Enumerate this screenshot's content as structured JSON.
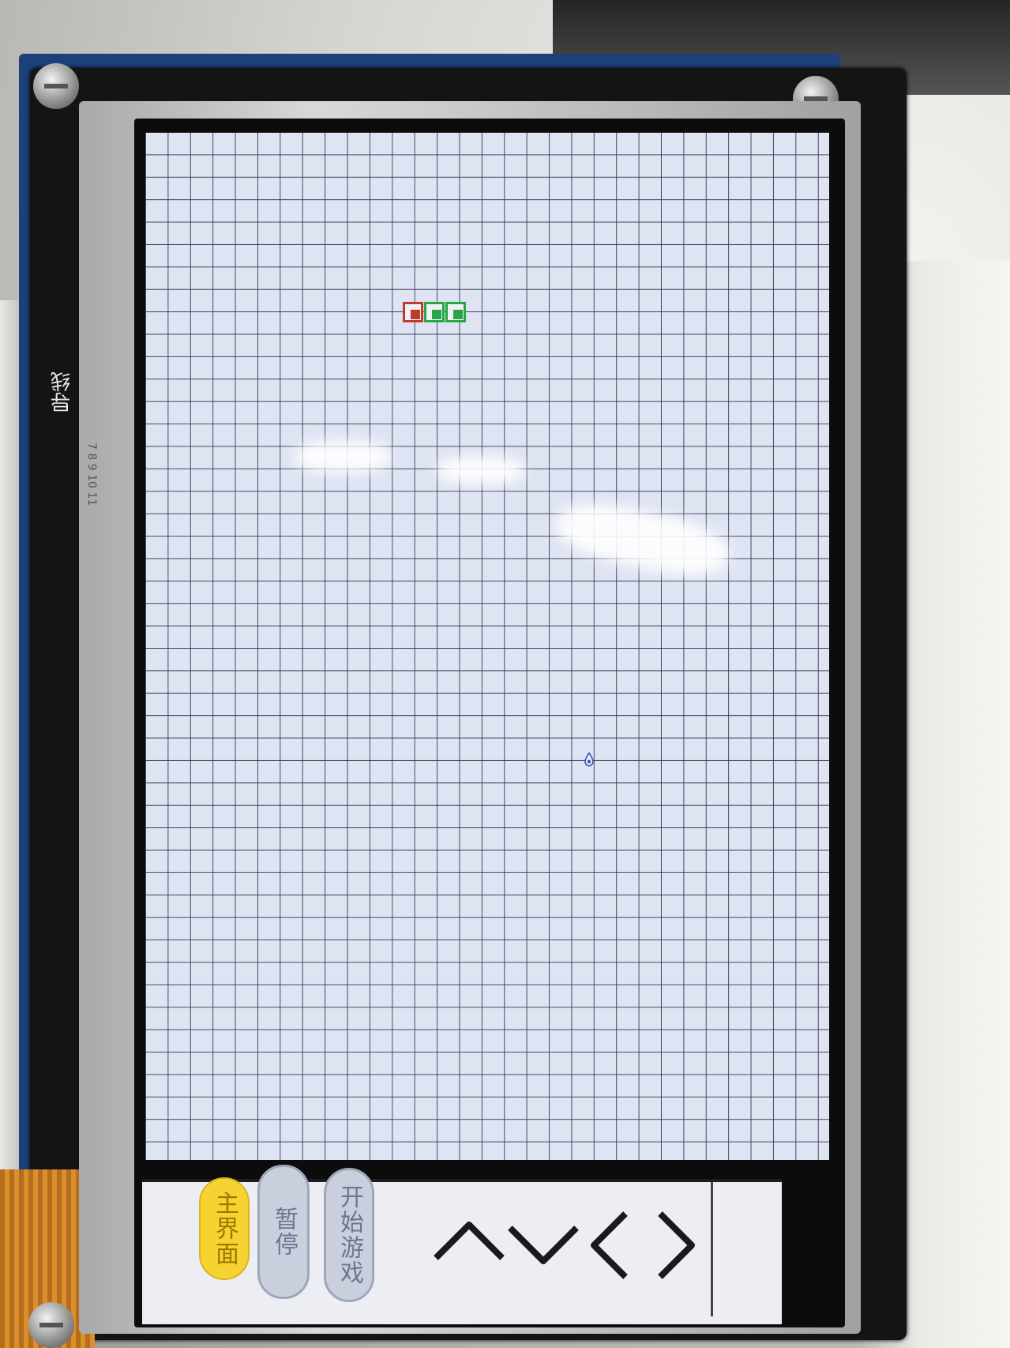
{
  "device": {
    "side_label": "导线",
    "ruler_marks": "7 8 9 10 11"
  },
  "game": {
    "grid": {
      "columns": 30,
      "rows": 46
    },
    "snake": [
      {
        "role": "head",
        "color": "#c0392b"
      },
      {
        "role": "body",
        "color": "#27a844"
      },
      {
        "role": "body",
        "color": "#27a844"
      }
    ],
    "food_icon": "drop-icon"
  },
  "controls": {
    "main_menu_label": "主界面",
    "pause_label": "暂停",
    "start_label": "开始游戏",
    "main_menu_color": "#f7d331",
    "arrows": [
      "up-arrow-icon",
      "down-arrow-icon",
      "left-arrow-icon",
      "right-arrow-icon"
    ]
  }
}
